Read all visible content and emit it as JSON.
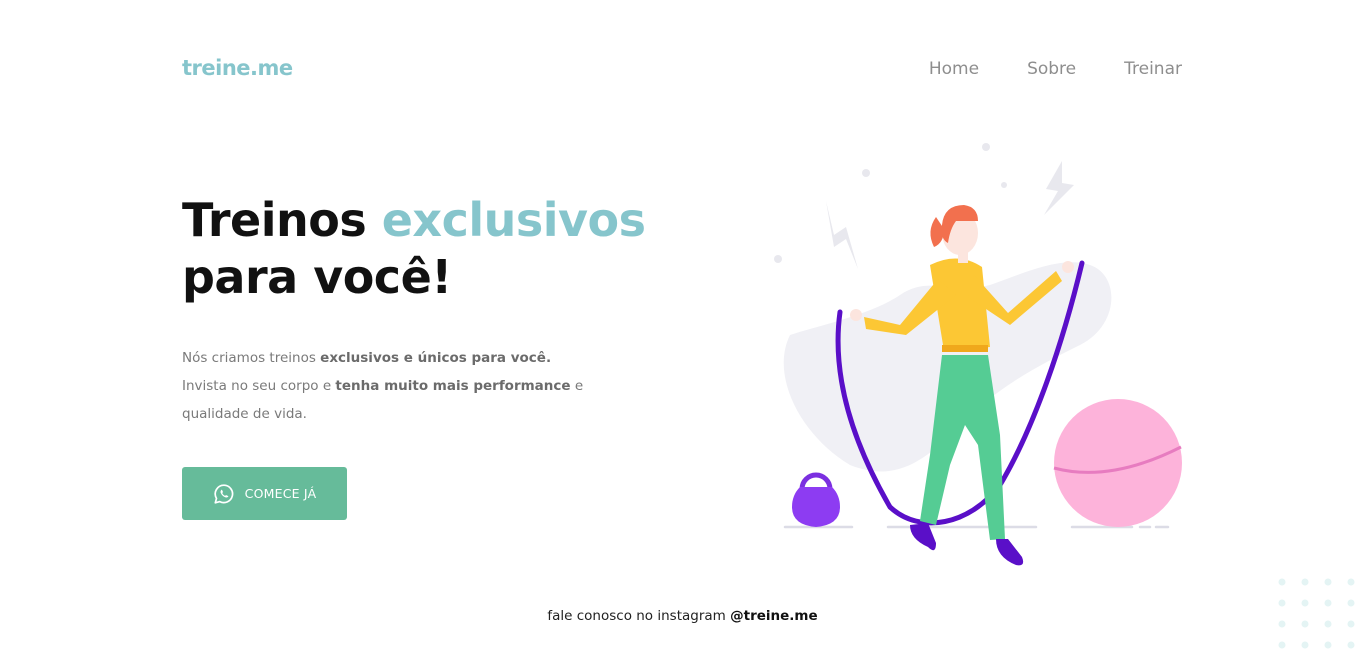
{
  "header": {
    "logo": "treine.me",
    "nav": [
      {
        "label": "Home"
      },
      {
        "label": "Sobre"
      },
      {
        "label": "Treinar"
      }
    ]
  },
  "hero": {
    "title_part1": "Treinos",
    "title_accent": "exclusivos",
    "title_line2": "para você!",
    "desc_line1_a": "Nós criamos treinos",
    "desc_line1_b": "exclusivos e únicos para você.",
    "desc_line2_a": "Invista no seu corpo e",
    "desc_line2_b": "tenha muito mais performance",
    "desc_line2_c": "e",
    "desc_line3": "qualidade de vida.",
    "cta_label": "COMECE JÁ",
    "cta_icon": "whatsapp-icon"
  },
  "footer": {
    "text": "fale conosco no instagram",
    "handle": "@treine.me"
  },
  "colors": {
    "accent": "#86c5cc",
    "cta": "#66bb9a",
    "nav": "#8e8e8e",
    "rope": "#5a0fc8",
    "kettlebell": "#8d3cf2",
    "ball": "#fdb3da",
    "jacket": "#fcc734",
    "pants": "#55cc94",
    "hair": "#f2704e"
  }
}
